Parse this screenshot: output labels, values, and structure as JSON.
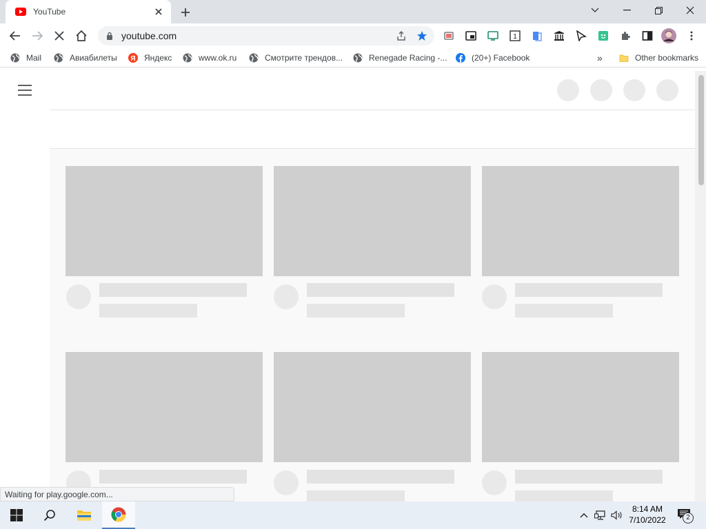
{
  "browser": {
    "tab": {
      "title": "YouTube"
    },
    "address": {
      "url": "youtube.com"
    },
    "bookmarks": [
      {
        "label": "Mail",
        "icon": "globe-icon"
      },
      {
        "label": "Авиабилеты",
        "icon": "globe-icon"
      },
      {
        "label": "Яндекс",
        "icon": "yandex-icon"
      },
      {
        "label": "www.ok.ru",
        "icon": "globe-icon"
      },
      {
        "label": "Смотрите трендов...",
        "icon": "globe-icon"
      },
      {
        "label": "Renegade Racing -...",
        "icon": "globe-icon"
      },
      {
        "label": "(20+) Facebook",
        "icon": "facebook-icon"
      }
    ],
    "overflow_label": "»",
    "other_bookmarks": "Other bookmarks",
    "status": "Waiting for play.google.com...",
    "colors": {
      "accent": "#1a73e8",
      "youtube_red": "#ff0000",
      "tabstrip": "#dee1e6"
    }
  },
  "taskbar": {
    "time": "8:14 AM",
    "date": "7/10/2022",
    "notifications": "2"
  }
}
